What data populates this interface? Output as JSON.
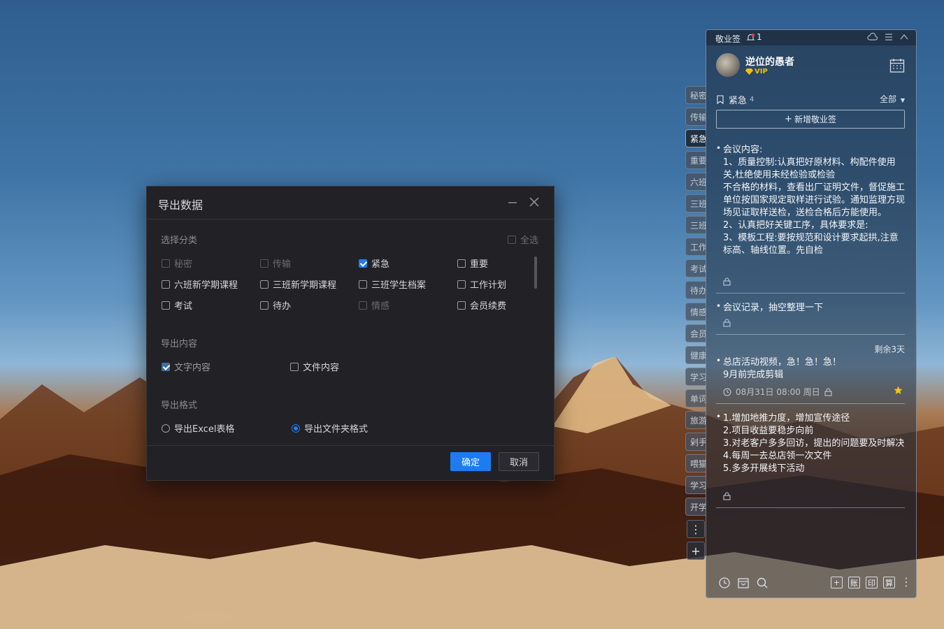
{
  "dialog": {
    "title": "导出数据",
    "select_category_label": "选择分类",
    "select_all_label": "全选",
    "categories": [
      {
        "label": "秘密",
        "checked": false,
        "disabled": true
      },
      {
        "label": "传输",
        "checked": false,
        "disabled": true
      },
      {
        "label": "紧急",
        "checked": true,
        "disabled": false
      },
      {
        "label": "重要",
        "checked": false,
        "disabled": false
      },
      {
        "label": "六班新学期课程",
        "checked": false,
        "disabled": false
      },
      {
        "label": "三班新学期课程",
        "checked": false,
        "disabled": false
      },
      {
        "label": "三班学生档案",
        "checked": false,
        "disabled": false
      },
      {
        "label": "工作计划",
        "checked": false,
        "disabled": false
      },
      {
        "label": "考试",
        "checked": false,
        "disabled": false
      },
      {
        "label": "待办",
        "checked": false,
        "disabled": false
      },
      {
        "label": "情感",
        "checked": false,
        "disabled": true
      },
      {
        "label": "会员续费",
        "checked": false,
        "disabled": false
      }
    ],
    "export_content_label": "导出内容",
    "content_text_label": "文字内容",
    "content_file_label": "文件内容",
    "export_format_label": "导出格式",
    "format_excel_label": "导出Excel表格",
    "format_folder_label": "导出文件夹格式",
    "ok_label": "确定",
    "cancel_label": "取消"
  },
  "side_tabs": [
    "秘密",
    "传输",
    "紧急",
    "重要",
    "六班",
    "三班",
    "三班",
    "工作",
    "考试",
    "待办",
    "情感",
    "会员",
    "健康",
    "学习",
    "单词",
    "旅游",
    "剁手",
    "喂猫",
    "学习",
    "开学"
  ],
  "side_active_index": 2,
  "panel": {
    "app_title": "敬业签",
    "notification_count": "1",
    "user_name": "逆位的愚者",
    "vip_label": "VIP",
    "category_name": "紧急",
    "category_count": "4",
    "filter_label": "全部",
    "add_note_label": "新增敬业签",
    "notes": [
      {
        "text": "会议内容:\n1、质量控制:认真把好原材料、构配件使用关,杜绝使用未经检验或检验\n不合格的材料，查看出厂证明文件，督促施工单位按国家规定取样进行试验。通知监理方现场见证取样送检，送检合格后方能使用。\n2、认真把好关键工序，具体要求是:\n3、模板工程:要按规范和设计要求起拱,注意标高、轴线位置。先自检"
      },
      {
        "text": "会议记录，抽空整理一下"
      },
      {
        "text": "总店活动视频，急！急！急！\n9月前完成剪辑",
        "remaining": "剩余3天",
        "date": "08月31日 08:00 周日"
      },
      {
        "text": "1.增加地推力度，增加宣传途径\n2.项目收益要稳步向前\n3.对老客户多多回访，提出的问题要及时解决\n4.每周一去总店领一次文件\n5.多多开展线下活动"
      }
    ],
    "bottom_chars": [
      "账",
      "印",
      "算"
    ]
  },
  "colors": {
    "accent": "#1e7cf2",
    "vip": "#f2c200",
    "star": "#f5c518"
  }
}
